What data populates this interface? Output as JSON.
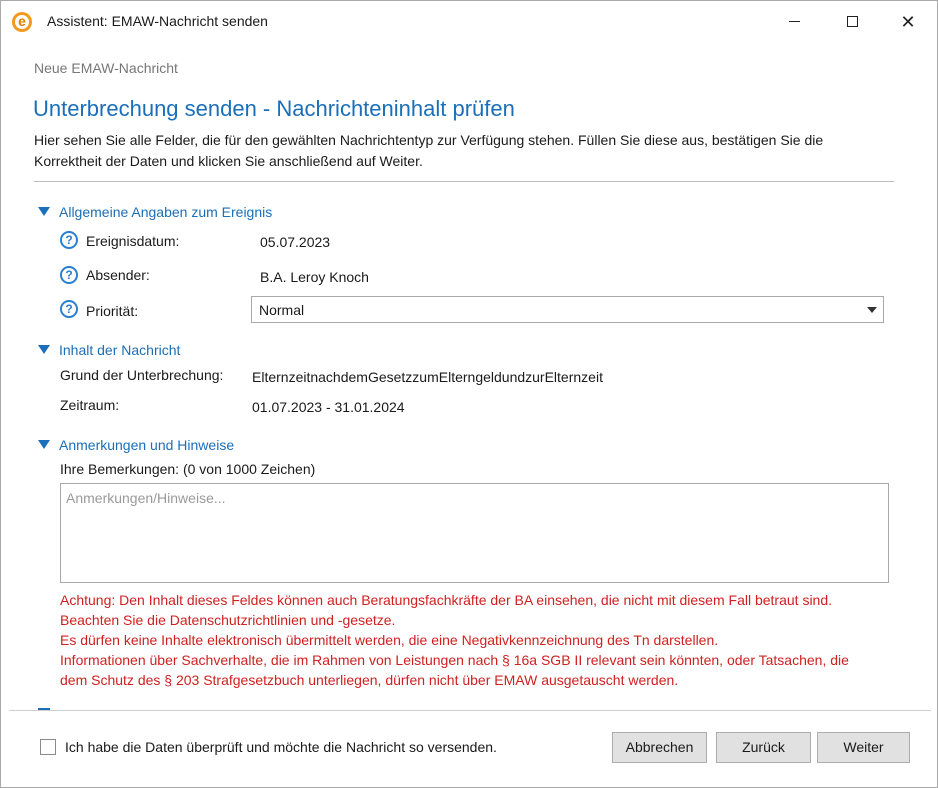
{
  "window": {
    "title": "Assistent: EMAW-Nachricht senden",
    "app_icon_letter": "e",
    "controls": [
      "minimize-icon",
      "maximize-icon",
      "close-icon"
    ],
    "close_glyph": "✕"
  },
  "breadcrumb": "Neue EMAW-Nachricht",
  "page_title": "Unterbrechung senden - Nachrichteninhalt prüfen",
  "intro_text": "Hier sehen Sie alle Felder, die für den gewählten Nachrichtentyp zur Verfügung stehen. Füllen Sie diese aus, bestätigen Sie die Korrektheit der Daten und klicken Sie anschließend auf Weiter.",
  "sections": {
    "general": {
      "title": "Allgemeine Angaben zum Ereignis",
      "fields": {
        "event_date_label": "Ereignisdatum:",
        "event_date_value": "05.07.2023",
        "sender_label": "Absender:",
        "sender_value": "B.A. Leroy Knoch",
        "priority_label": "Priorität:",
        "priority_value": "Normal"
      }
    },
    "content": {
      "title": "Inhalt der Nachricht",
      "reason_label": "Grund der Unterbrechung:",
      "reason_value": "ElternzeitnachdemGesetzzumElterngeldundzurElternzeit",
      "period_label": "Zeitraum:",
      "period_value": "01.07.2023 - 31.01.2024"
    },
    "notes": {
      "title": "Anmerkungen und Hinweise",
      "remarks_label": "Ihre Bemerkungen: (0 von 1000 Zeichen)",
      "remarks_value": "",
      "remarks_placeholder": "Anmerkungen/Hinweise...",
      "warning_lines": [
        "Achtung: Den Inhalt dieses Feldes können auch Beratungsfachkräfte der BA einsehen, die nicht mit diesem Fall betraut sind.",
        "Beachten Sie die Datenschutzrichtlinien und -gesetze.",
        "Es dürfen keine Inhalte elektronisch übermittelt werden, die eine Negativkennzeichnung des Tn darstellen.",
        "Informationen über Sachverhalte, die im Rahmen von Leistungen nach § 16a SGB II relevant sein könnten, oder Tatsachen, die",
        "dem Schutz des § 203 Strafgesetzbuch unterliegen, dürfen nicht über EMAW ausgetauscht werden."
      ]
    }
  },
  "help_icon_glyph": "?",
  "footer": {
    "confirm_checkbox_checked": false,
    "confirm_label": "Ich habe die Daten überprüft und möchte die Nachricht so versenden.",
    "buttons": {
      "cancel": "Abbrechen",
      "back": "Zurück",
      "next": "Weiter"
    }
  },
  "colors": {
    "accent_blue": "#1a6fb8",
    "warning_red": "#d02020",
    "app_icon_orange": "#f39a1e"
  }
}
